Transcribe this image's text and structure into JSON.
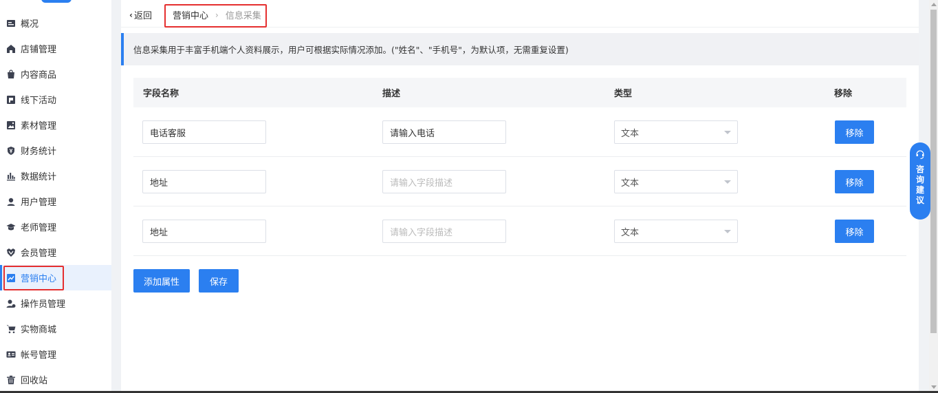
{
  "sidebar": {
    "items": [
      {
        "label": "概况",
        "icon": "overview-icon"
      },
      {
        "label": "店铺管理",
        "icon": "store-icon"
      },
      {
        "label": "内容商品",
        "icon": "shopping-bag-icon"
      },
      {
        "label": "线下活动",
        "icon": "flag-icon"
      },
      {
        "label": "素材管理",
        "icon": "image-icon"
      },
      {
        "label": "财务统计",
        "icon": "yuan-shield-icon"
      },
      {
        "label": "数据统计",
        "icon": "bar-chart-icon"
      },
      {
        "label": "用户管理",
        "icon": "user-icon"
      },
      {
        "label": "老师管理",
        "icon": "graduation-cap-icon"
      },
      {
        "label": "会员管理",
        "icon": "vip-icon"
      },
      {
        "label": "营销中心",
        "icon": "trend-chart-icon",
        "active": true
      },
      {
        "label": "操作员管理",
        "icon": "operator-icon"
      },
      {
        "label": "实物商城",
        "icon": "cart-icon"
      },
      {
        "label": "帐号管理",
        "icon": "id-card-icon"
      },
      {
        "label": "回收站",
        "icon": "trash-icon"
      }
    ]
  },
  "header": {
    "back_label": "返回",
    "breadcrumb": [
      "营销中心",
      "信息采集"
    ]
  },
  "notice": "信息采集用于丰富手机端个人资料展示，用户可根据实际情况添加。(\"姓名\"、\"手机号\"，为默认项，无需重复设置)",
  "table": {
    "columns": [
      "字段名称",
      "描述",
      "类型",
      "移除"
    ],
    "rows": [
      {
        "name": "电话客服",
        "desc_value": "请输入电话",
        "desc_placeholder": "",
        "type": "文本",
        "remove_label": "移除"
      },
      {
        "name": "地址",
        "desc_value": "",
        "desc_placeholder": "请输入字段描述",
        "type": "文本",
        "remove_label": "移除"
      },
      {
        "name": "地址",
        "desc_value": "",
        "desc_placeholder": "请输入字段描述",
        "type": "文本",
        "remove_label": "移除"
      }
    ]
  },
  "actions": {
    "add_label": "添加属性",
    "save_label": "保存"
  },
  "feedback": {
    "label_chars": [
      "咨",
      "询",
      "建",
      "议"
    ]
  },
  "colors": {
    "primary": "#2b7ff0",
    "highlight_border": "#e52e2e"
  }
}
